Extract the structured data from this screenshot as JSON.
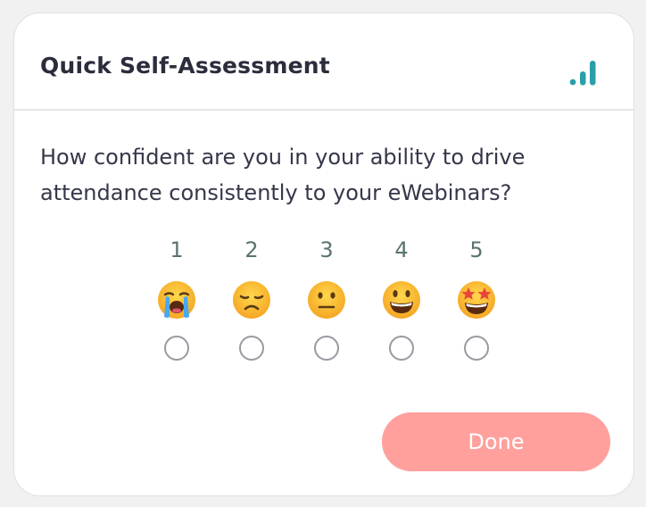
{
  "header": {
    "title": "Quick Self-Assessment",
    "icon": "signal-bars-icon",
    "icon_color": "#2a9fa7"
  },
  "question": "How confident are you in your ability to drive attendance consistently to your eWebinars?",
  "scale": {
    "options": [
      {
        "number": "1",
        "emoji": "loudly-crying-face-icon"
      },
      {
        "number": "2",
        "emoji": "disappointed-face-icon"
      },
      {
        "number": "3",
        "emoji": "neutral-face-icon"
      },
      {
        "number": "4",
        "emoji": "grinning-face-icon"
      },
      {
        "number": "5",
        "emoji": "star-struck-face-icon"
      }
    ],
    "selected": null
  },
  "footer": {
    "done_label": "Done",
    "done_color": "#ffa09d"
  }
}
